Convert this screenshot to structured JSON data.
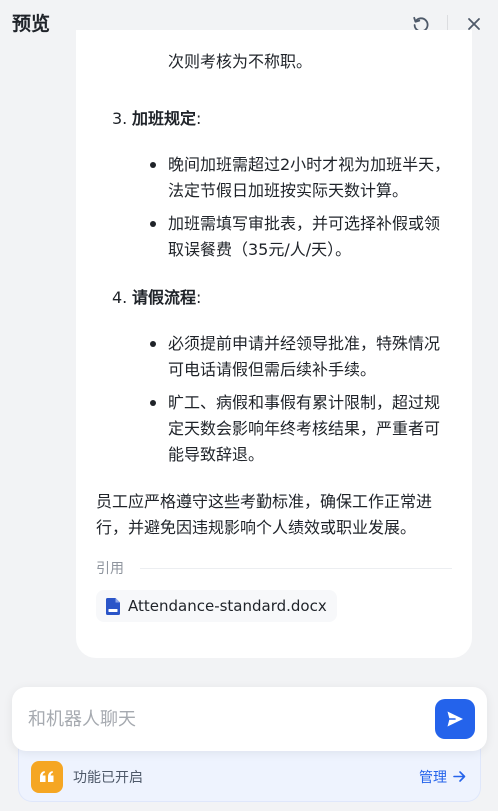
{
  "header": {
    "title": "预览",
    "refresh_icon": "refresh-icon",
    "close_icon": "close-icon"
  },
  "message": {
    "partial_line": "次则考核为不称职。",
    "sections": [
      {
        "number": "3.",
        "title": "加班规定",
        "colon": ":",
        "bullets": [
          "晚间加班需超过2小时才视为加班半天，法定节假日加班按实际天数计算。",
          "加班需填写审批表，并可选择补假或领取误餐费（35元/人/天）。"
        ]
      },
      {
        "number": "4.",
        "title": "请假流程",
        "colon": ":",
        "bullets": [
          "必须提前申请并经领导批准，特殊情况可电话请假但需后续补手续。",
          "旷工、病假和事假有累计限制，超过规定天数会影响年终考核结果，严重者可能导致辞退。"
        ]
      }
    ],
    "summary": "员工应严格遵守这些考勤标准，确保工作正常进行，并避免因违规影响个人绩效或职业发展。",
    "citation_label": "引用",
    "citation_file": "Attendance-standard.docx"
  },
  "composer": {
    "placeholder": "和机器人聊天",
    "value": "",
    "send_icon": "send-icon"
  },
  "feature": {
    "status": "功能已开启",
    "manage_label": "管理"
  },
  "colors": {
    "accent": "#2463eb",
    "feature_icon": "#f5a623",
    "page_bg": "#f2f3f5"
  }
}
